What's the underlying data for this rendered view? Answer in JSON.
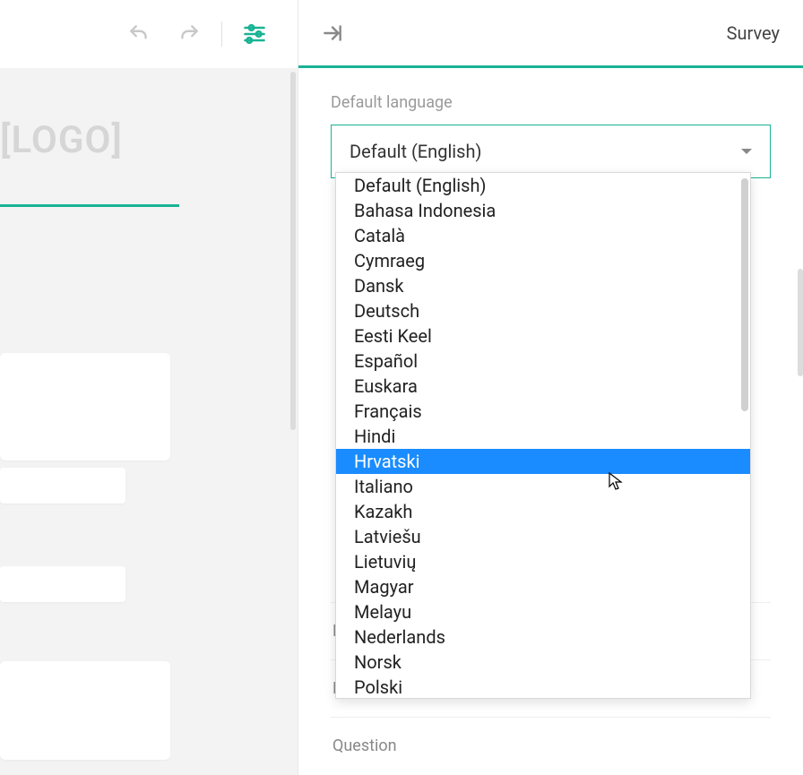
{
  "leftPanel": {
    "logoPlaceholder": "[LOGO]"
  },
  "rightPanel": {
    "title": "Survey",
    "defaultLanguageLabel": "Default language",
    "selectedLanguage": "Default (English)",
    "languageOptions": [
      "Default (English)",
      "Bahasa Indonesia",
      "Català",
      "Cymraeg",
      "Dansk",
      "Deutsch",
      "Eesti Keel",
      "Español",
      "Euskara",
      "Français",
      "Hindi",
      "Hrvatski",
      "Italiano",
      "Kazakh",
      "Latviešu",
      "Lietuvių",
      "Magyar",
      "Melayu",
      "Nederlands",
      "Norsk",
      "Polski"
    ],
    "highlightedOption": "Hrvatski",
    "sections": {
      "logo": "Lo",
      "navigation": "Na",
      "question": "Question"
    }
  },
  "icons": {
    "undo": "undo-icon",
    "redo": "redo-icon",
    "settings": "settings-sliders-icon",
    "collapse": "collapse-right-icon",
    "caret": "caret-down-icon"
  }
}
